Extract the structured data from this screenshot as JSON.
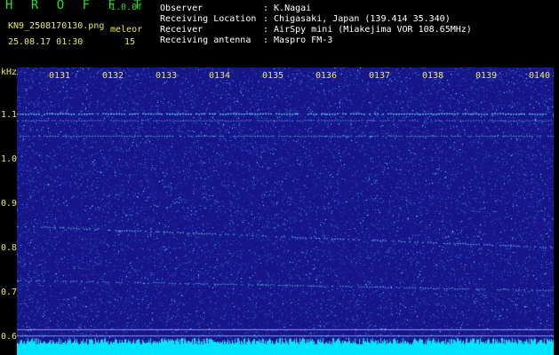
{
  "header": {
    "brand": "H R O F F T",
    "version": "1.0.0f",
    "filename": "KN9_2508170130.png",
    "timestamp": "25.08.17 01:30",
    "mode_label": "meleor",
    "mode_value": "15",
    "info": [
      {
        "label": "Observer",
        "value": ": K.Nagai"
      },
      {
        "label": "Receiving Location",
        "value": ": Chigasaki, Japan (139.414 35.340)"
      },
      {
        "label": "Receiver",
        "value": ": AirSpy mini (Miakejima VOR 108.65MHz)"
      },
      {
        "label": "Receiving antenna",
        "value": ": Maspro FM-3"
      }
    ]
  },
  "y_axis": {
    "unit": "kHz",
    "ticks": [
      "1.1",
      "1.0",
      "0.9",
      "0.8",
      "0.7",
      "0.6"
    ]
  },
  "x_axis": {
    "ticks": [
      "0131",
      "0132",
      "0133",
      "0134",
      "0135",
      "0136",
      "0137",
      "0138",
      "0139",
      "0140"
    ]
  },
  "colors": {
    "background": "#16168a",
    "noise": "#2b4fd6",
    "trace": "#7fe8ff",
    "baseline": "#00e5ff",
    "text": "#e8e85a",
    "brand": "#22dd22"
  }
}
